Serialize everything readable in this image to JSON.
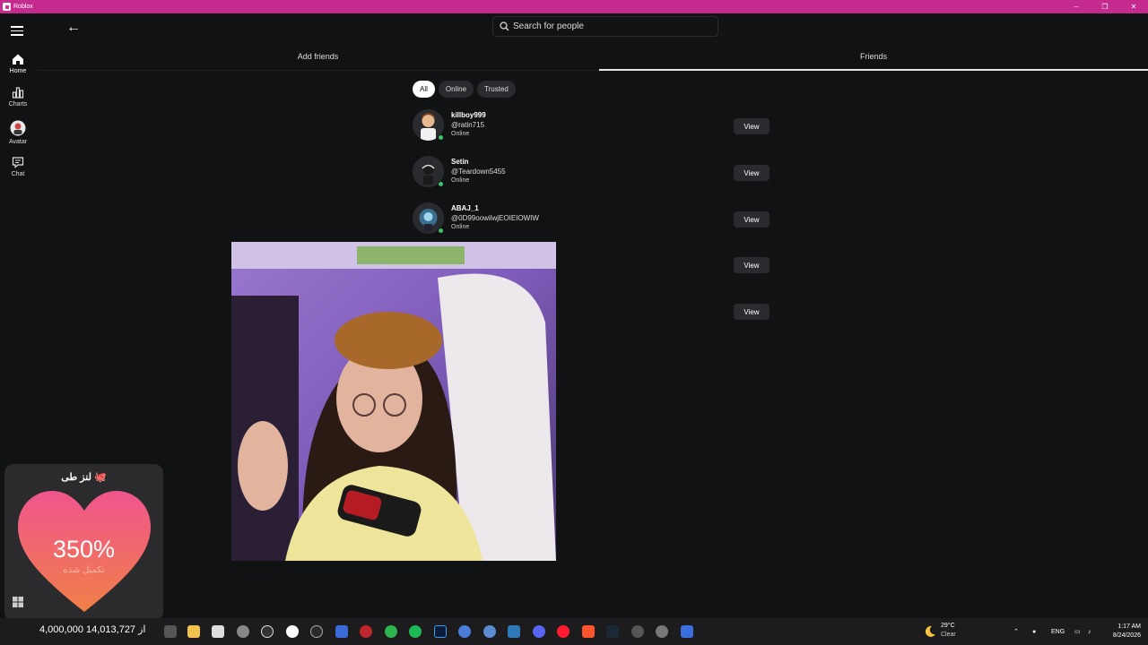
{
  "window": {
    "title": "Roblox"
  },
  "sidebar": {
    "items": [
      {
        "label": "Home"
      },
      {
        "label": "Charts"
      },
      {
        "label": "Avatar"
      },
      {
        "label": "Chat"
      }
    ]
  },
  "search": {
    "placeholder": "Search for people"
  },
  "tabs": {
    "add_friends": "Add friends",
    "friends": "Friends"
  },
  "filters": [
    {
      "label": "All",
      "active": true
    },
    {
      "label": "Online",
      "active": false
    },
    {
      "label": "Trusted",
      "active": false
    }
  ],
  "friends": [
    {
      "name": "killboy999",
      "handle": "@ratin715",
      "status": "Online"
    },
    {
      "name": "Setin",
      "handle": "@Teardown5455",
      "status": "Online"
    },
    {
      "name": "ABAJ_1",
      "handle": "@0D99oowilwjEOIEIOWIW",
      "status": "Online"
    }
  ],
  "view_label": "View",
  "widget": {
    "title": "لنز طی 🐙",
    "percent": "350%",
    "subtitle": "تکمیل شده",
    "count": "4,000,000 از 14,013,727"
  },
  "taskbar": {
    "weather_temp": "29°C",
    "weather_desc": "Clear",
    "lang": "ENG",
    "time": "1:17 AM",
    "date": "8/24/2026"
  },
  "colors": {
    "titlebar": "#c52b8e",
    "online": "#3ec46b",
    "background": "#111214"
  }
}
